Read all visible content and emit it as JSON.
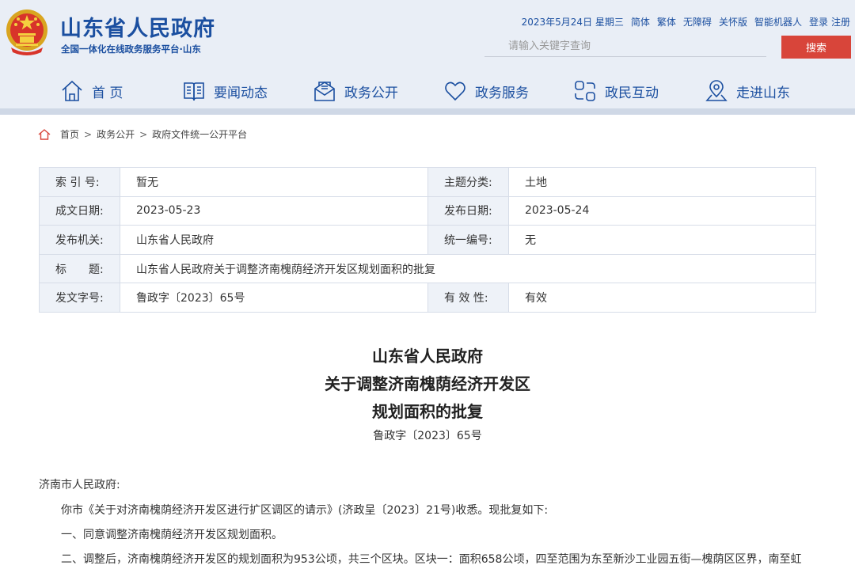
{
  "header": {
    "title": "山东省人民政府",
    "subtitle": "全国一体化在线政务服务平台·山东",
    "date": "2023年5月24日 星期三",
    "links": [
      "简体",
      "繁体",
      "无障碍",
      "关怀版",
      "智能机器人",
      "登录",
      "注册"
    ],
    "search_placeholder": "请输入关键字查询",
    "search_button": "搜索",
    "colors": {
      "brand": "#1b4fa0",
      "accent": "#d8453a",
      "header_bg": "#e9eef6"
    }
  },
  "nav": [
    {
      "label": "首 页",
      "icon": "home-icon"
    },
    {
      "label": "要闻动态",
      "icon": "news-icon"
    },
    {
      "label": "政务公开",
      "icon": "mail-open-icon"
    },
    {
      "label": "政务服务",
      "icon": "heart-icon"
    },
    {
      "label": "政民互动",
      "icon": "interaction-icon"
    },
    {
      "label": "走进山东",
      "icon": "location-icon"
    }
  ],
  "breadcrumb": [
    "首页",
    "政务公开",
    "政府文件统一公开平台"
  ],
  "meta": {
    "index_label": "索 引 号:",
    "index_value": "暂无",
    "topic_label": "主题分类:",
    "topic_value": "土地",
    "written_label": "成文日期:",
    "written_value": "2023-05-23",
    "publish_label": "发布日期:",
    "publish_value": "2023-05-24",
    "issuer_label": "发布机关:",
    "issuer_value": "山东省人民政府",
    "serial_label": "统一编号:",
    "serial_value": "无",
    "title_label": "标　　题:",
    "title_value": "山东省人民政府关于调整济南槐荫经济开发区规划面积的批复",
    "docno_label": "发文字号:",
    "docno_value": "鲁政字〔2023〕65号",
    "validity_label": "有 效 性:",
    "validity_value": "有效"
  },
  "document": {
    "title_line1": "山东省人民政府",
    "title_line2": "关于调整济南槐荫经济开发区",
    "title_line3": "规划面积的批复",
    "doc_number": "鲁政字〔2023〕65号",
    "salutation": "济南市人民政府:",
    "para1": "你市《关于对济南槐荫经济开发区进行扩区调区的请示》(济政呈〔2023〕21号)收悉。现批复如下:",
    "para2": "一、同意调整济南槐荫经济开发区规划面积。",
    "para3": "二、调整后，济南槐荫经济开发区的规划面积为953公顷，共三个区块。区块一：面积658公顷，四至范围为东至新沙工业园五街—槐荫区区界，南至虹"
  }
}
